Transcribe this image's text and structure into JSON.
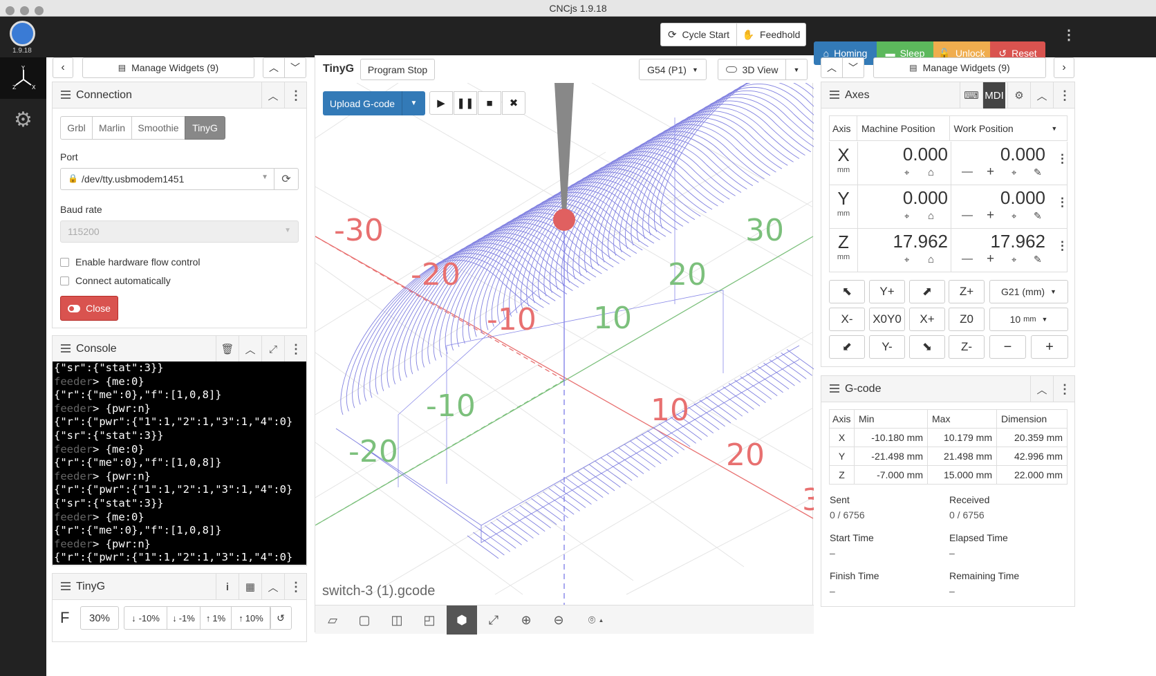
{
  "window": {
    "title": "CNCjs 1.9.18"
  },
  "app": {
    "version": "1.9.18"
  },
  "topbar": {
    "cycle_start": "Cycle Start",
    "feedhold": "Feedhold",
    "homing": "Homing",
    "sleep": "Sleep",
    "unlock": "Unlock",
    "reset": "Reset"
  },
  "colors": {
    "primary": "#337ab7",
    "success": "#5cb85c",
    "warning": "#f0ad4e",
    "danger": "#d9534f",
    "bg_dark": "#222222"
  },
  "left": {
    "manage_widgets": "Manage Widgets (9)",
    "connection": {
      "title": "Connection",
      "tabs": [
        "Grbl",
        "Marlin",
        "Smoothie",
        "TinyG"
      ],
      "active_tab": "TinyG",
      "port_label": "Port",
      "port_value": "/dev/tty.usbmodem1451",
      "baud_label": "Baud rate",
      "baud_value": "115200",
      "hw_flow": "Enable hardware flow control",
      "auto_connect": "Connect automatically",
      "close": "Close"
    },
    "console": {
      "title": "Console",
      "lines": [
        {
          "t": "{\"sr\":{\"stat\":3}}",
          "fd": false
        },
        {
          "t": "> {me:0}",
          "fd": true
        },
        {
          "t": "{\"r\":{\"me\":0},\"f\":[1,0,8]}",
          "fd": false
        },
        {
          "t": "> {pwr:n}",
          "fd": true
        },
        {
          "t": "{\"r\":{\"pwr\":{\"1\":1,\"2\":1,\"3\":1,\"4\":0}",
          "fd": false
        },
        {
          "t": "{\"sr\":{\"stat\":3}}",
          "fd": false
        },
        {
          "t": "> {me:0}",
          "fd": true
        },
        {
          "t": "{\"r\":{\"me\":0},\"f\":[1,0,8]}",
          "fd": false
        },
        {
          "t": "> {pwr:n}",
          "fd": true
        },
        {
          "t": "{\"r\":{\"pwr\":{\"1\":1,\"2\":1,\"3\":1,\"4\":0}",
          "fd": false
        },
        {
          "t": "{\"sr\":{\"stat\":3}}",
          "fd": false
        },
        {
          "t": "> {me:0}",
          "fd": true
        },
        {
          "t": "{\"r\":{\"me\":0},\"f\":[1,0,8]}",
          "fd": false
        },
        {
          "t": "> {pwr:n}",
          "fd": true
        },
        {
          "t": "{\"r\":{\"pwr\":{\"1\":1,\"2\":1,\"3\":1,\"4\":0}",
          "fd": false
        }
      ],
      "feeder": "feeder"
    },
    "tinyg": {
      "title": "TinyG",
      "f_label": "F",
      "f_value": "30%",
      "btns": [
        "-10%",
        "-1%",
        "1%",
        "10%"
      ]
    }
  },
  "viz": {
    "title": "TinyG",
    "program_stop": "Program Stop",
    "wcs": "G54 (P1)",
    "view": "3D View",
    "upload": "Upload G-code",
    "filename": "switch-3 (1).gcode",
    "x_labels": [
      "-30",
      "-20",
      "-10",
      "10",
      "20",
      "30"
    ],
    "y_labels": [
      "-20",
      "-10",
      "10",
      "20"
    ]
  },
  "right": {
    "manage_widgets": "Manage Widgets (9)",
    "axes": {
      "title": "Axes",
      "mdi": "MDI",
      "col_axis": "Axis",
      "col_machine": "Machine Position",
      "col_work": "Work Position",
      "rows": [
        {
          "axis": "X",
          "unit": "mm",
          "machine": "0.000",
          "work": "0.000"
        },
        {
          "axis": "Y",
          "unit": "mm",
          "machine": "0.000",
          "work": "0.000"
        },
        {
          "axis": "Z",
          "unit": "mm",
          "machine": "17.962",
          "work": "17.962"
        }
      ],
      "jog": {
        "yplus": "Y+",
        "zplus": "Z+",
        "units": "G21 (mm)",
        "xminus": "X-",
        "xoyo": "X0Y0",
        "xplus": "X+",
        "zo": "Z0",
        "step": "10",
        "step_unit": "mm",
        "yminus": "Y-",
        "zminus": "Z-",
        "minus": "−",
        "plus": "+"
      }
    },
    "gcode": {
      "title": "G-code",
      "headers": [
        "Axis",
        "Min",
        "Max",
        "Dimension"
      ],
      "rows": [
        [
          "X",
          "-10.180 mm",
          "10.179 mm",
          "20.359 mm"
        ],
        [
          "Y",
          "-21.498 mm",
          "21.498 mm",
          "42.996 mm"
        ],
        [
          "Z",
          "-7.000 mm",
          "15.000 mm",
          "22.000 mm"
        ]
      ],
      "sent_label": "Sent",
      "sent": "0 / 6756",
      "received_label": "Received",
      "received": "0 / 6756",
      "start_label": "Start Time",
      "start": "–",
      "elapsed_label": "Elapsed Time",
      "elapsed": "–",
      "finish_label": "Finish Time",
      "finish": "–",
      "remaining_label": "Remaining Time",
      "remaining": "–"
    }
  }
}
